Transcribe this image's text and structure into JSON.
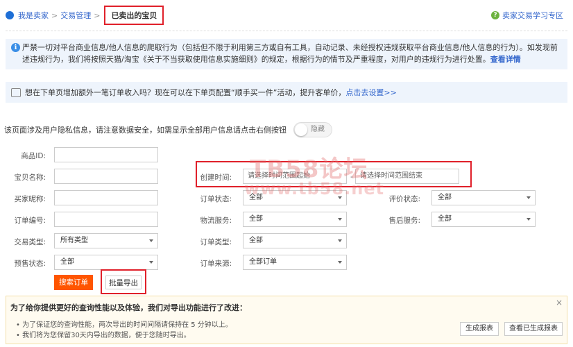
{
  "breadcrumb": {
    "home": "我是卖家",
    "sep": ">",
    "mid": "交易管理",
    "current": "已卖出的宝贝"
  },
  "help": {
    "icon": "question-icon",
    "label": "卖家交易学习专区"
  },
  "notice": {
    "text": "严禁一切对平台商业信息/他人信息的爬取行为（包括但不限于利用第三方或自有工具，自动记录、未经授权违规获取平台商业信息/他人信息的行为）。如发现前述违规行为，我们将按照天猫/淘宝《关于不当获取使用信息实施细则》的规定，根据行为的情节及严重程度，对用户的违规行为进行处置。",
    "link": "查看详情"
  },
  "promo": {
    "text": "想在下单页增加额外一笔订单收入吗？现在可以在下单页配置“顺手买一件”活动，提升客单价，",
    "link": "点击去设置>>"
  },
  "privacy": {
    "text": "该页面涉及用户隐私信息，请注意数据安全，如需显示全部用户信息请点击右侧按钮",
    "toggle": "隐藏"
  },
  "form": {
    "item_id": {
      "label": "商品ID:",
      "value": ""
    },
    "item_name": {
      "label": "宝贝名称:",
      "value": ""
    },
    "buyer": {
      "label": "买家昵称:",
      "value": ""
    },
    "order_no": {
      "label": "订单编号:",
      "value": ""
    },
    "trade_type": {
      "label": "交易类型:",
      "value": "所有类型"
    },
    "presale": {
      "label": "预售状态:",
      "value": "全部"
    },
    "created": {
      "label": "创建时间:",
      "start_placeholder": "请选择时间范围起始",
      "sep": "-",
      "end_placeholder": "请选择时间范围结束"
    },
    "order_status": {
      "label": "订单状态:",
      "value": "全部"
    },
    "logistics": {
      "label": "物流服务:",
      "value": "全部"
    },
    "order_type": {
      "label": "订单类型:",
      "value": "全部"
    },
    "order_source": {
      "label": "订单来源:",
      "value": "全部订单"
    },
    "rating": {
      "label": "评价状态:",
      "value": "全部"
    },
    "aftersale": {
      "label": "售后服务:",
      "value": "全部"
    }
  },
  "buttons": {
    "search": "搜索订单",
    "export": "批量导出"
  },
  "watermark": {
    "line1": "TB58论坛",
    "line2": "www.tb58.net"
  },
  "panel": {
    "title": "为了给你提供更好的查询性能以及体验，我们对导出功能进行了改进：",
    "bullets": [
      "为了保证您的查询性能，两次导出的时间间隔请保持在 5 分钟以上。",
      "我们将为您保留30天内导出的数据，便于您随时导出。"
    ],
    "generate": "生成报表",
    "view": "查看已生成报表",
    "close": "×"
  }
}
